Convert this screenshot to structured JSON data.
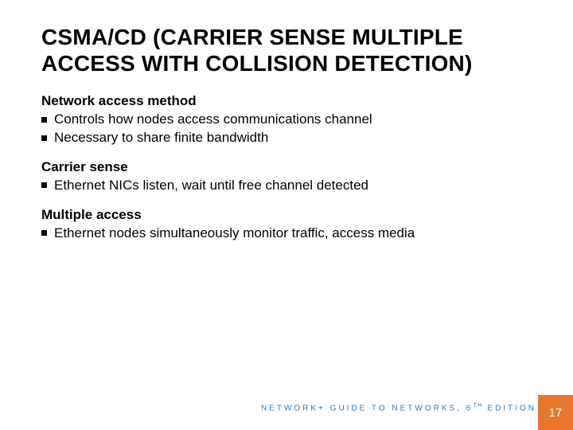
{
  "title_line1": "CSMA/CD (CARRIER SENSE MULTIPLE",
  "title_line2": "ACCESS WITH COLLISION DETECTION)",
  "sections": [
    {
      "heading": "Network access method",
      "bullets": [
        "Controls how nodes access communications channel",
        "Necessary to share finite bandwidth"
      ]
    },
    {
      "heading": "Carrier sense",
      "bullets": [
        "Ethernet NICs listen, wait until free channel detected"
      ]
    },
    {
      "heading": "Multiple access",
      "bullets": [
        "Ethernet nodes simultaneously monitor traffic, access media"
      ]
    }
  ],
  "footer_pre": "NETWORK+  GUIDE TO NETWORKS, 6",
  "footer_sup": "TH",
  "footer_post": " EDITION",
  "page_number": "17",
  "colors": {
    "accent": "#e8762d",
    "link": "#2f78b9"
  }
}
